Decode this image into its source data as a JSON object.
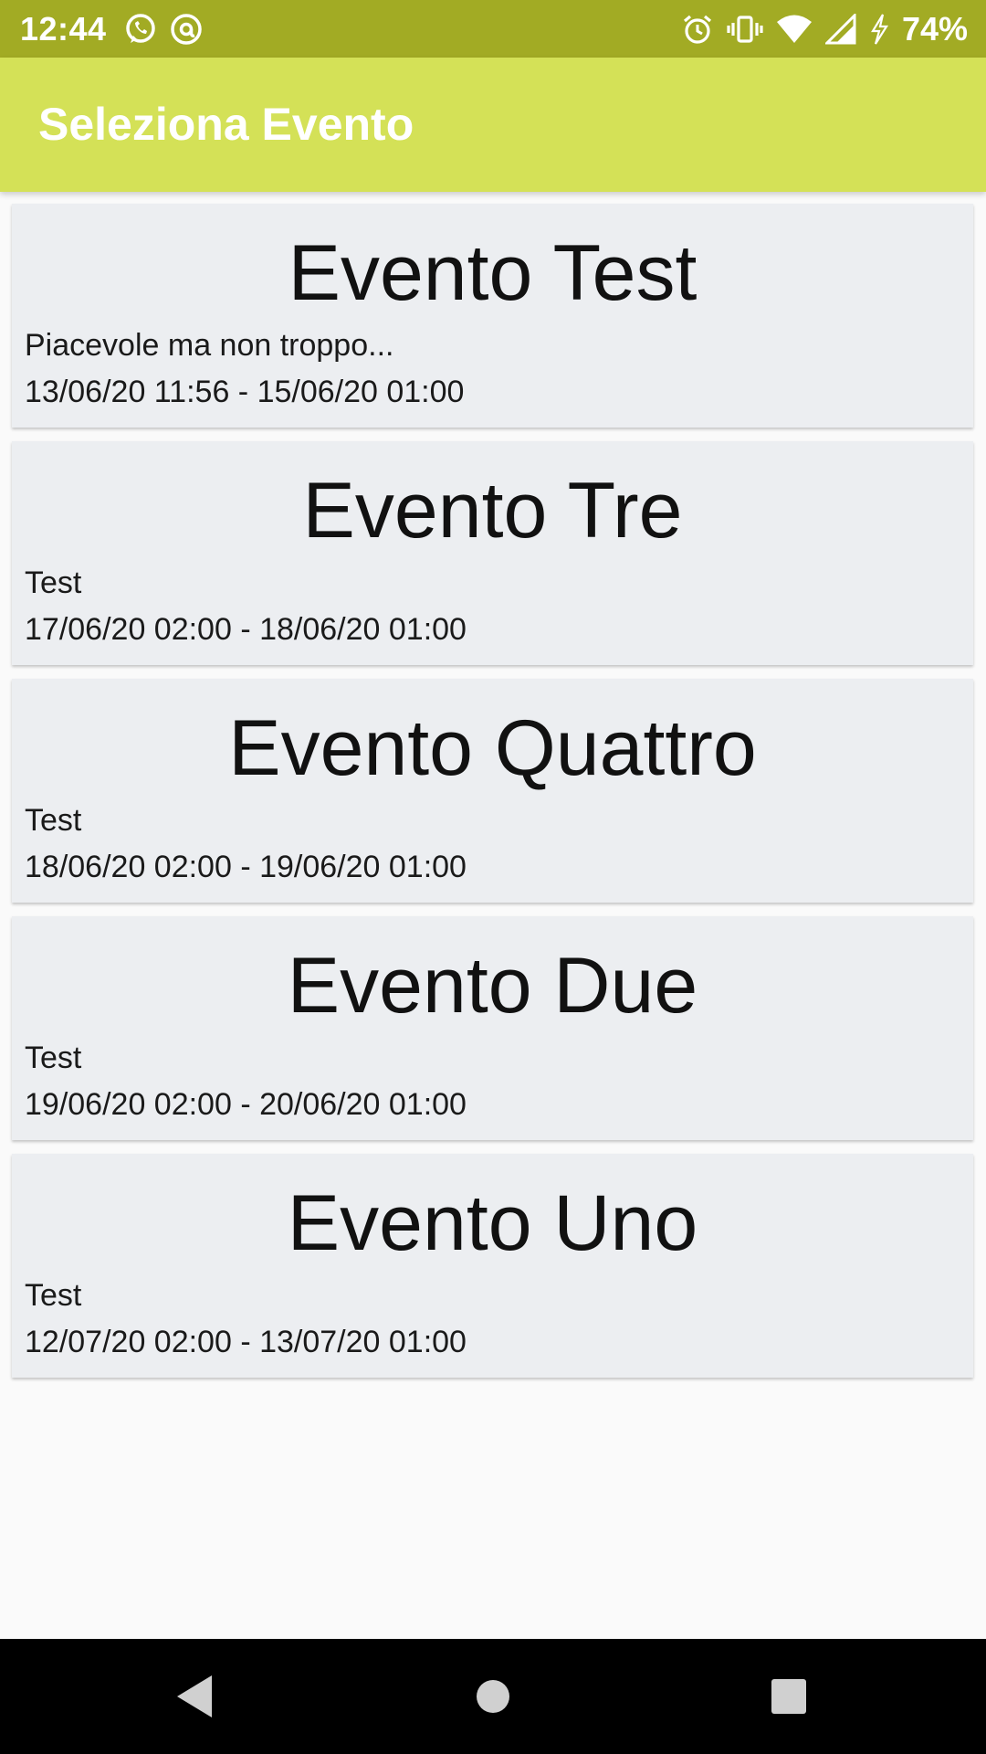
{
  "status_bar": {
    "time": "12:44",
    "battery": "74%",
    "left_icons": [
      "whatsapp-icon",
      "at-sign-icon"
    ],
    "right_icons": [
      "alarm-icon",
      "vibrate-icon",
      "wifi-icon",
      "signal-icon",
      "charging-icon"
    ],
    "color": "#a2ab24"
  },
  "app_bar": {
    "title": "Seleziona Evento",
    "color": "#d4e157"
  },
  "events": [
    {
      "title": "Evento Test",
      "description": "Piacevole ma non troppo...",
      "dates": "13/06/20 11:56 - 15/06/20 01:00"
    },
    {
      "title": "Evento Tre",
      "description": "Test",
      "dates": "17/06/20 02:00 - 18/06/20 01:00"
    },
    {
      "title": "Evento Quattro",
      "description": "Test",
      "dates": "18/06/20 02:00 - 19/06/20 01:00"
    },
    {
      "title": "Evento Due",
      "description": "Test",
      "dates": "19/06/20 02:00 - 20/06/20 01:00"
    },
    {
      "title": "Evento Uno",
      "description": "Test",
      "dates": "12/07/20 02:00 - 13/07/20 01:00"
    }
  ],
  "nav_bar": {
    "buttons": [
      "back-icon",
      "home-icon",
      "recents-icon"
    ]
  }
}
